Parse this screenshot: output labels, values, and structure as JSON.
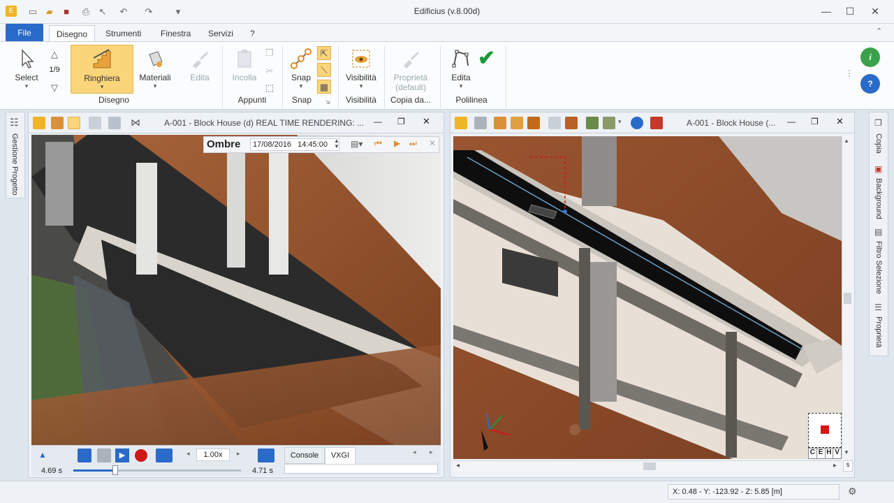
{
  "app": {
    "title": "Edificius (v.8.00d)"
  },
  "tabs": {
    "file": "File",
    "disegno": "Disegno",
    "strumenti": "Strumenti",
    "finestra": "Finestra",
    "servizi": "Servizi",
    "help": "?"
  },
  "ribbon": {
    "select": "Select",
    "counter": "1/9",
    "ringhiera": "Ringhiera",
    "materiali": "Materiali",
    "edita_dim": "Edita",
    "incolla": "Incolla",
    "snap": "Snap",
    "visibilita": "Visibilità",
    "proprieta": "Proprietà",
    "proprieta_sub": "(default)",
    "edita": "Edita",
    "groups": {
      "disegno": "Disegno",
      "appunti": "Appunti",
      "snap": "Snap",
      "visibilita": "Visibilità",
      "copia": "Copia da...",
      "polilinea": "Polilinea"
    }
  },
  "left_panel": {
    "title": "A-001 - Block House (d)  REAL TIME RENDERING: ...",
    "ombre_label": "Ombre",
    "date": "17/08/2016",
    "time": "14:45:00",
    "time_start": "4.69 s",
    "time_end": "4.71 s",
    "speed": "1.00x",
    "tabs": {
      "console": "Console",
      "vxgi": "VXGI"
    },
    "progress": 0.25
  },
  "right_panel": {
    "title": "A-001 - Block House (...",
    "nav_letters": [
      "C",
      "E",
      "H",
      "V"
    ],
    "scroll_letter": "s"
  },
  "side_tabs": {
    "left": "Gestione Progetto",
    "right": [
      "Copia",
      "Background",
      "Filtro Selezione",
      "Proprietà"
    ]
  },
  "status": {
    "coords": "X: 0.48 - Y: -123.92 - Z: 5.85 [m]"
  },
  "colors": {
    "accent": "#2a6ac8",
    "highlight": "#f7c948",
    "check": "#1a9a3a"
  }
}
